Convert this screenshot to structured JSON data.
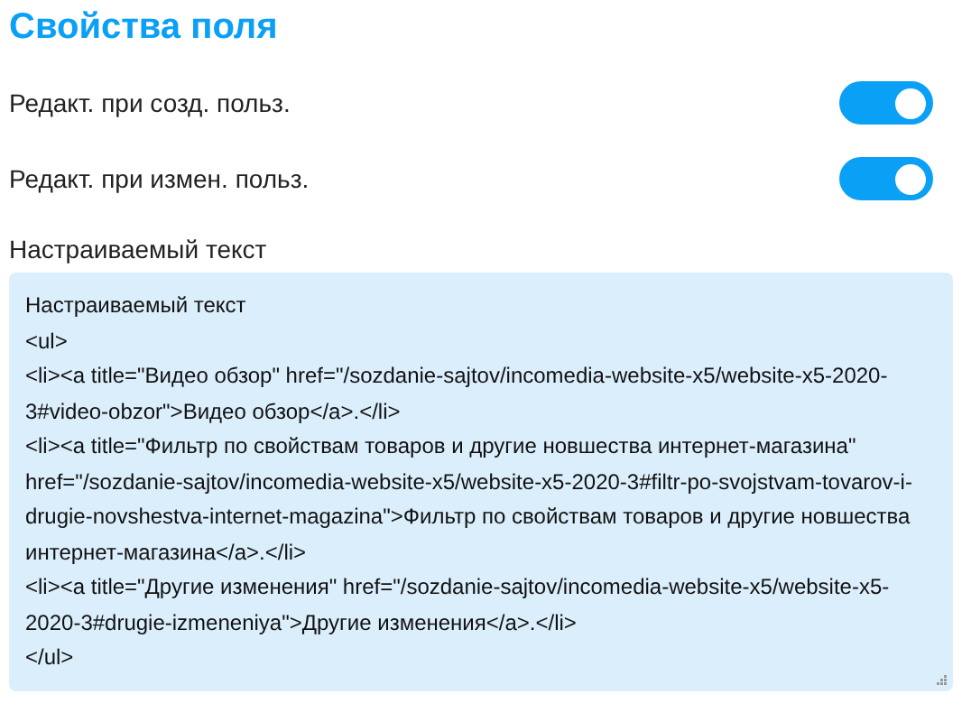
{
  "title": "Свойства поля",
  "toggles": [
    {
      "label": "Редакт. при созд. польз.",
      "on": true
    },
    {
      "label": "Редакт. при измен. польз.",
      "on": true
    }
  ],
  "custom_text": {
    "label": "Настраиваемый текст",
    "value": "Настраиваемый текст\n<ul>\n<li><a title=\"Видео обзор\" href=\"/sozdanie-sajtov/incomedia-website-x5/website-x5-2020-3#video-obzor\">Видео обзор</a>.</li>\n<li><a title=\"Фильтр по свойствам товаров и другие новшества интернет-магазина\" href=\"/sozdanie-sajtov/incomedia-website-x5/website-x5-2020-3#filtr-po-svojstvam-tovarov-i-drugie-novshestva-internet-magazina\">Фильтр по свойствам товаров и другие новшества интернет-магазина</a>.</li>\n<li><a title=\"Другие изменения\" href=\"/sozdanie-sajtov/incomedia-website-x5/website-x5-2020-3#drugie-izmeneniya\">Другие изменения</a>.</li>\n</ul>"
  }
}
